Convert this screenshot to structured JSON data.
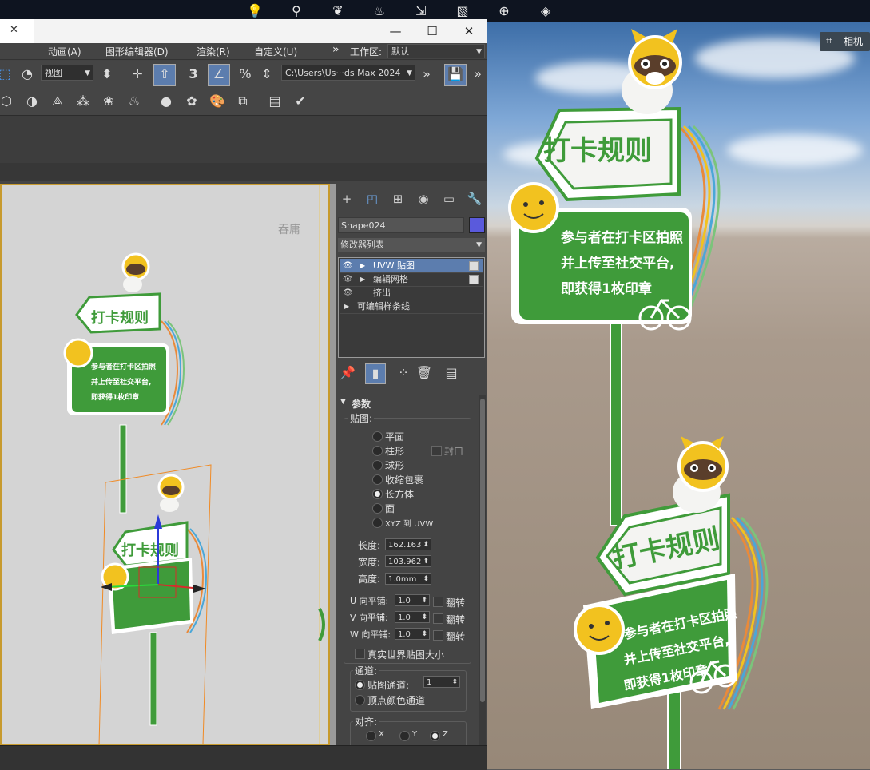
{
  "taskbar": {
    "icons": [
      "lightbulb-icon",
      "node-icon",
      "leaf-icon",
      "flame-icon",
      "import-icon",
      "ruler-icon",
      "pin-add-icon",
      "layers-icon"
    ]
  },
  "titlebar": {
    "minimize": "—",
    "maximize": "☐",
    "close": "✕",
    "tab_close": "✕"
  },
  "menubar": {
    "items": [
      "动画(A)",
      "图形编辑器(D)",
      "渲染(R)",
      "自定义(U)"
    ],
    "more": "»",
    "workspace_label": "工作区:",
    "workspace_value": "默认"
  },
  "toolbar": {
    "view_dropdown": "视图",
    "path_dropdown": "C:\\Users\\Us···ds Max 2024",
    "snap_label": "3"
  },
  "command_panel": {
    "object_name": "Shape024",
    "modifier_list": "修改器列表",
    "stack": [
      {
        "label": "UVW 贴图",
        "selected": true,
        "arrow": true,
        "check": true
      },
      {
        "label": "编辑网格",
        "selected": false,
        "arrow": true,
        "check": true
      },
      {
        "label": "挤出",
        "selected": false,
        "arrow": false,
        "check": false
      },
      {
        "label": "可编辑样条线",
        "selected": false,
        "arrow": true,
        "check": false
      }
    ],
    "rollout_title": "参数",
    "mapping": {
      "title": "贴图:",
      "options": [
        "平面",
        "柱形",
        "球形",
        "收缩包裹",
        "长方体",
        "面",
        "XYZ 到 UVW"
      ],
      "selected": "长方体",
      "cap_label": "封口"
    },
    "dims": {
      "length_label": "长度:",
      "length": "162.163",
      "width_label": "宽度:",
      "width": "103.962",
      "height_label": "高度:",
      "height": "1.0mm"
    },
    "tile": {
      "u_label": "U 向平铺:",
      "u": "1.0",
      "v_label": "V 向平铺:",
      "v": "1.0",
      "w_label": "W 向平铺:",
      "w": "1.0",
      "flip_label": "翻转"
    },
    "real_world": "真实世界贴图大小",
    "channel": {
      "title": "通道:",
      "map_channel": "贴图通道:",
      "map_channel_value": "1",
      "vertex_color": "顶点颜色通道"
    },
    "align": {
      "title": "对齐:",
      "axes": [
        "X",
        "Y",
        "Z"
      ],
      "selected": "Z"
    }
  },
  "viewport": {
    "watermark": "吞庸"
  },
  "preview": {
    "camera_label": "相机",
    "sign_title": "打卡规则",
    "sign_lines": [
      "参与者在打卡区拍照",
      "并上传至社交平台,",
      "即获得1枚印章"
    ],
    "viewport_sign_lines": [
      "参与者在打卡区拍照",
      "并上传至社交平台,",
      "即获得1枚印章"
    ]
  },
  "colors": {
    "sign_green": "#3f9b3a",
    "sign_white": "#f4f4f2",
    "selection_blue": "#5c7dae",
    "object_color": "#5a5adc",
    "mascot_yellow": "#f2c21f"
  }
}
